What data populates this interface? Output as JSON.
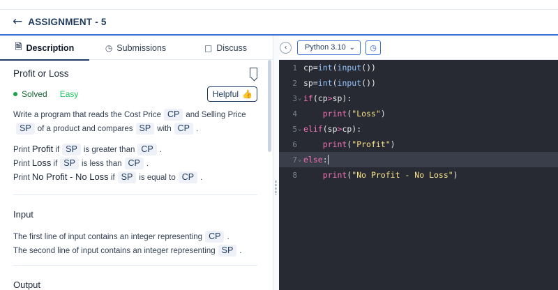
{
  "header": {
    "back_icon": "arrow-left-icon",
    "title": "ASSIGNMENT - 5"
  },
  "tabs": [
    {
      "label": "Description",
      "icon": "document-icon",
      "active": true
    },
    {
      "label": "Submissions",
      "icon": "clock-icon",
      "active": false
    },
    {
      "label": "Discuss",
      "icon": "chat-icon",
      "active": false
    }
  ],
  "problem": {
    "title": "Profit or Loss",
    "status": "Solved",
    "difficulty": "Easy",
    "helpful_label": "Helpful",
    "desc": {
      "l1a": "Write a program that reads the Cost Price",
      "cp": "CP",
      "l1b": "and Selling Price",
      "sp": "SP",
      "l2a": "of a product and compares",
      "with": "with",
      "print": "Print",
      "profit": "Profit",
      "loss": "Loss",
      "noprofit": "No Profit - No Loss",
      "if": "if",
      "greater": "is greater than",
      "less": "is less than",
      "equal": "is equal to",
      "dot": "."
    },
    "input_title": "Input",
    "input_l1": "The first line of input contains an integer representing",
    "input_l2": "The second line of input contains an integer representing",
    "output_title": "Output"
  },
  "editor": {
    "language": "Python 3.10",
    "lines": [
      {
        "n": "1"
      },
      {
        "n": "2"
      },
      {
        "n": "3"
      },
      {
        "n": "4"
      },
      {
        "n": "5"
      },
      {
        "n": "6"
      },
      {
        "n": "7"
      },
      {
        "n": "8"
      }
    ],
    "tokens": {
      "cp": "cp",
      "sp": "sp",
      "eq": "=",
      "int": "int",
      "input": "input",
      "parens": "()",
      "lp": "(",
      "rp": ")",
      "colon": ":",
      "gt": ">",
      "if": "if",
      "elif": "elif",
      "else": "else",
      "print": "print",
      "s_loss": "\"Loss\"",
      "s_profit": "\"Profit\"",
      "s_none": "\"No Profit - No Loss\""
    }
  },
  "colors": {
    "accent": "#3b6fd4",
    "navy": "#1e3a5f",
    "solved": "#16a34a",
    "easy": "#22c55e",
    "editor_bg": "#272a33"
  }
}
